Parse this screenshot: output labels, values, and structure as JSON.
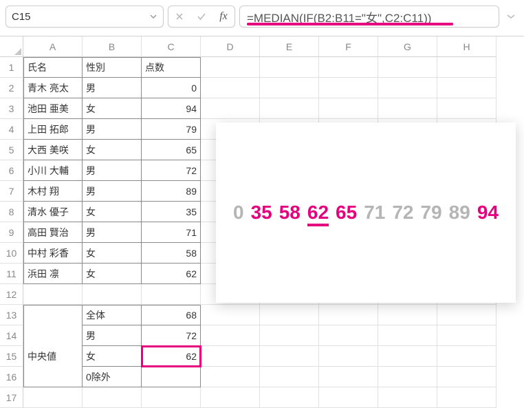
{
  "name_box": "C15",
  "formula": "=MEDIAN(IF(B2:B11=\"女\",C2:C11))",
  "columns": [
    "A",
    "B",
    "C",
    "D",
    "E",
    "F",
    "G",
    "H"
  ],
  "row_headers": [
    1,
    2,
    3,
    4,
    5,
    6,
    7,
    8,
    9,
    10,
    11,
    12,
    13,
    14,
    15,
    16,
    17
  ],
  "table": {
    "header": {
      "a": "氏名",
      "b": "性別",
      "c": "点数"
    },
    "rows": [
      {
        "a": "青木 亮太",
        "b": "男",
        "c": 0
      },
      {
        "a": "池田 亜美",
        "b": "女",
        "c": 94
      },
      {
        "a": "上田 拓郎",
        "b": "男",
        "c": 79
      },
      {
        "a": "大西 美咲",
        "b": "女",
        "c": 65
      },
      {
        "a": "小川 大輔",
        "b": "男",
        "c": 72
      },
      {
        "a": "木村 翔",
        "b": "男",
        "c": 89
      },
      {
        "a": "清水 優子",
        "b": "女",
        "c": 35
      },
      {
        "a": "高田 賢治",
        "b": "男",
        "c": 71
      },
      {
        "a": "中村 彩香",
        "b": "女",
        "c": 58
      },
      {
        "a": "浜田 凛",
        "b": "女",
        "c": 62
      }
    ]
  },
  "summary": {
    "label": "中央値",
    "rows": [
      {
        "b": "全体",
        "c": 68
      },
      {
        "b": "男",
        "c": 72
      },
      {
        "b": "女",
        "c": 62
      },
      {
        "b": "0除外",
        "c": ""
      }
    ]
  },
  "chart_data": {
    "type": "table",
    "title": "Sorted scores with female values highlighted; median of female group = 62",
    "values": [
      {
        "v": 0,
        "group": "male",
        "highlight": false
      },
      {
        "v": 35,
        "group": "female",
        "highlight": true
      },
      {
        "v": 58,
        "group": "female",
        "highlight": true
      },
      {
        "v": 62,
        "group": "female",
        "highlight": true,
        "median": true
      },
      {
        "v": 65,
        "group": "female",
        "highlight": true
      },
      {
        "v": 71,
        "group": "male",
        "highlight": false
      },
      {
        "v": 72,
        "group": "male",
        "highlight": false
      },
      {
        "v": 79,
        "group": "male",
        "highlight": false
      },
      {
        "v": 89,
        "group": "male",
        "highlight": false
      },
      {
        "v": 94,
        "group": "female",
        "highlight": true
      }
    ]
  }
}
